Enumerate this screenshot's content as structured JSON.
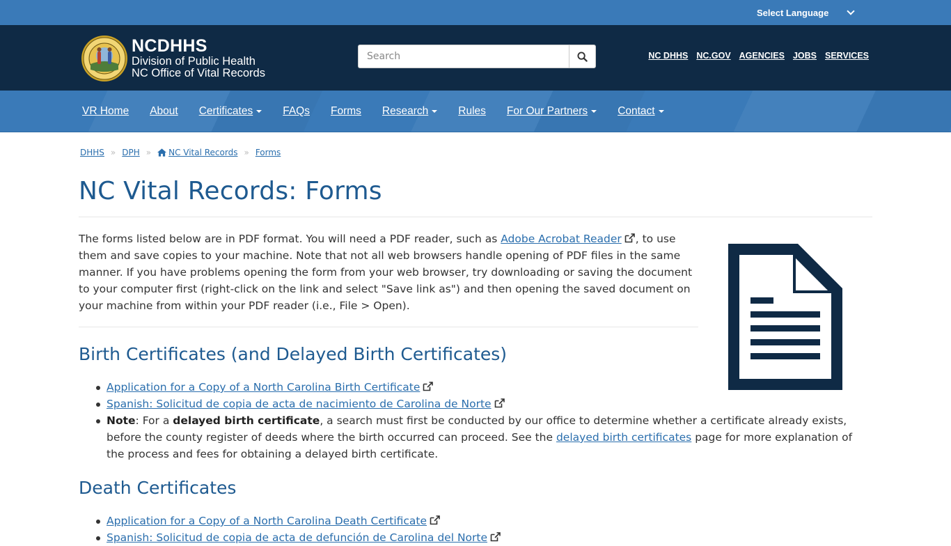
{
  "language": {
    "label": "Select Language"
  },
  "brand": {
    "title": "NCDHHS",
    "line1": "Division of Public Health",
    "line2": "NC Office of Vital Records"
  },
  "search": {
    "placeholder": "Search"
  },
  "top_links": [
    "NC DHHS",
    "NC.GOV",
    "AGENCIES",
    "JOBS",
    "SERVICES"
  ],
  "nav": [
    {
      "label": "VR Home",
      "dropdown": false
    },
    {
      "label": "About",
      "dropdown": false
    },
    {
      "label": "Certificates",
      "dropdown": true
    },
    {
      "label": "FAQs",
      "dropdown": false
    },
    {
      "label": "Forms",
      "dropdown": false
    },
    {
      "label": "Research",
      "dropdown": true
    },
    {
      "label": "Rules",
      "dropdown": false
    },
    {
      "label": "For Our Partners",
      "dropdown": true
    },
    {
      "label": "Contact",
      "dropdown": true
    }
  ],
  "breadcrumb": [
    "DHHS",
    "DPH",
    "NC Vital Records",
    "Forms"
  ],
  "page_title": "NC Vital Records: Forms",
  "intro": {
    "before": "The forms listed below are in PDF format. You will need a PDF reader, such as ",
    "link": "Adobe Acrobat Reader",
    "after": ", to use them and save copies to your machine. Note that not all web browsers handle opening of PDF files in the same manner. If you have problems opening the form from your web browser, try downloading or saving the document to your computer first (right-click on the link and select \"Save link as\") and then opening the saved document on your machine from within your PDF reader (i.e., File > Open)."
  },
  "birth": {
    "title": "Birth Certificates (and Delayed Birth Certificates)",
    "link1": "Application for a Copy of a North Carolina Birth Certificate",
    "link2": "Spanish: Solicitud de copia de acta de nacimiento de Carolina de Norte",
    "note_label": "Note",
    "note_a": ": For a ",
    "note_bold": "delayed birth certificate",
    "note_b": ", a search must first be conducted by our office to determine whether a certificate already exists, before the county register of deeds where the birth occurred can proceed. See the ",
    "note_link": "delayed birth certificates",
    "note_c": " page for more explanation of the process and fees for obtaining a delayed birth certificate."
  },
  "death": {
    "title": "Death Certificates",
    "link1": "Application for a Copy of a North Carolina Death Certificate",
    "link2": "Spanish: Solicitud de copia de acta de defunción de Carolina del Norte"
  },
  "colors": {
    "language_bar": "#3a7ab8",
    "header": "#0f2a45",
    "nav": "#3a7ab8",
    "heading": "#1e5a90",
    "link": "#2a6ead"
  }
}
